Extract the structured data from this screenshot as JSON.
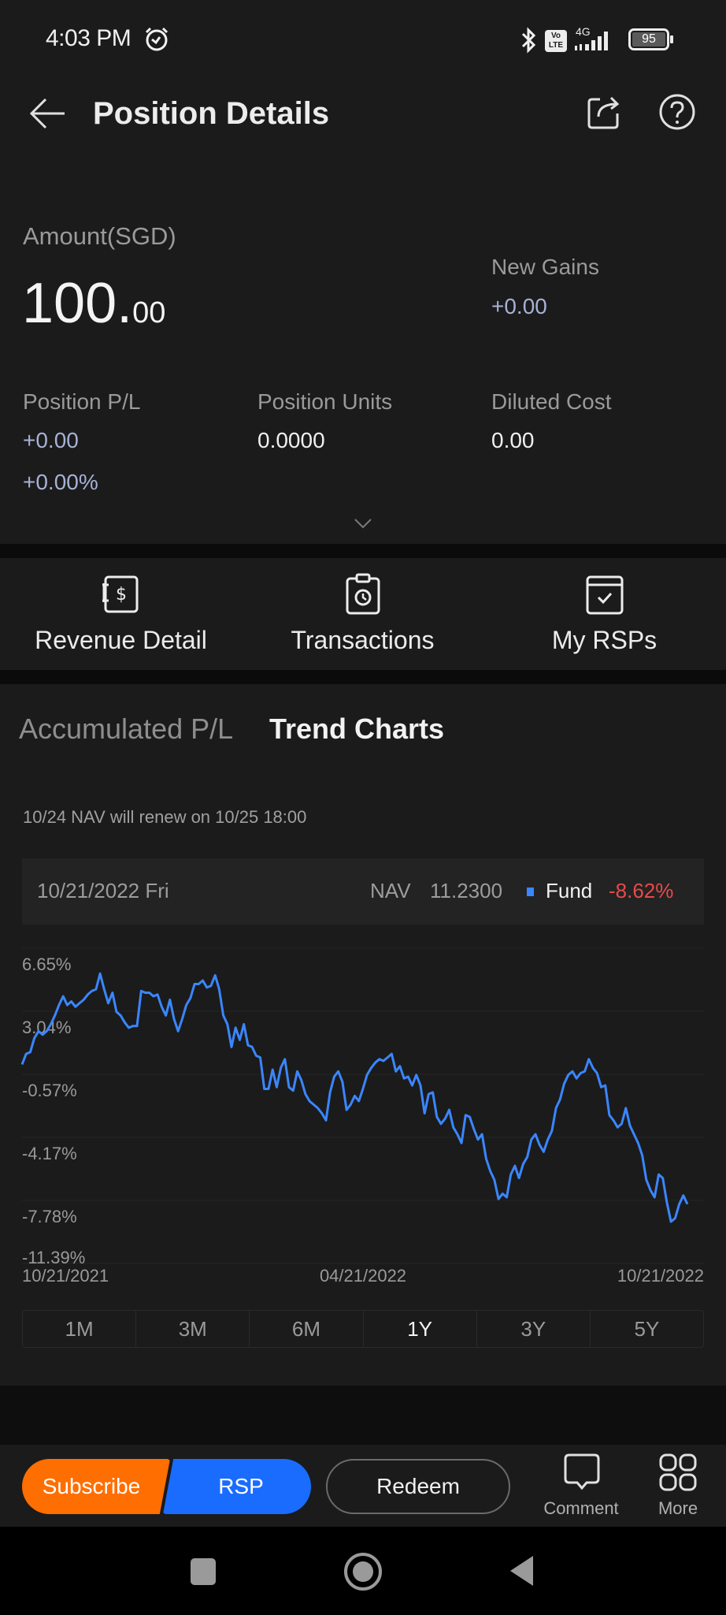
{
  "status_bar": {
    "time": "4:03 PM",
    "icons": [
      "alarm-icon",
      "bluetooth-icon",
      "volte-icon",
      "4g-signal-icon",
      "battery-icon"
    ],
    "network": "4G",
    "volte_line1": "Vo",
    "volte_line2": "LTE",
    "battery": "95"
  },
  "header": {
    "title": "Position Details",
    "back_icon": "arrow-left-icon",
    "share_icon": "share-icon",
    "help_icon": "help-icon"
  },
  "summary": {
    "amount_label": "Amount(SGD)",
    "amount_int": "100.",
    "amount_dec": "00",
    "new_gains_label": "New Gains",
    "new_gains_value": "+0.00",
    "position_pl_label": "Position P/L",
    "position_pl_value": "+0.00",
    "position_pl_pct": "+0.00%",
    "position_units_label": "Position Units",
    "position_units_value": "0.0000",
    "diluted_cost_label": "Diluted Cost",
    "diluted_cost_value": "0.00",
    "expand_icon": "chevron-down-icon"
  },
  "quick_actions": [
    {
      "label": "Revenue Detail",
      "icon": "revenue-dollar-icon"
    },
    {
      "label": "Transactions",
      "icon": "clipboard-clock-icon"
    },
    {
      "label": "My RSPs",
      "icon": "calendar-check-icon"
    }
  ],
  "tabs": [
    {
      "label": "Accumulated P/L",
      "active": false
    },
    {
      "label": "Trend Charts",
      "active": true
    }
  ],
  "nav_note": "10/24 NAV will renew on 10/25 18:00",
  "info_box": {
    "date": "10/21/2022 Fri",
    "nav_label": "NAV",
    "nav_value": "11.2300",
    "legend_label": "Fund",
    "legend_color": "#3a86ff",
    "change": "-8.62%",
    "change_color": "#e84a4a"
  },
  "chart_data": {
    "type": "line",
    "title": "",
    "xlabel": "",
    "ylabel": "",
    "y_tick_labels": [
      "6.65%",
      "3.04%",
      "-0.57%",
      "-4.17%",
      "-7.78%",
      "-11.39%"
    ],
    "y_ticks": [
      6.65,
      3.04,
      -0.57,
      -4.17,
      -7.78,
      -11.39
    ],
    "ylim": [
      -11.39,
      6.65
    ],
    "x_tick_labels": [
      "10/21/2021",
      "04/21/2022",
      "10/21/2022"
    ],
    "grid": true,
    "legend": "top-right",
    "series": [
      {
        "name": "Fund",
        "color": "#3a86ff",
        "x_range": [
          "10/21/2021",
          "10/21/2022"
        ],
        "values": [
          0.0,
          0.6,
          0.7,
          1.5,
          1.9,
          1.7,
          1.9,
          2.3,
          2.8,
          3.4,
          3.9,
          3.4,
          3.6,
          3.3,
          3.5,
          3.7,
          4.0,
          4.2,
          4.3,
          5.2,
          4.3,
          3.5,
          4.1,
          3.0,
          2.8,
          2.4,
          2.1,
          2.2,
          2.2,
          4.2,
          4.1,
          4.1,
          3.9,
          4.0,
          3.3,
          2.8,
          3.7,
          2.6,
          1.9,
          2.6,
          3.4,
          3.8,
          4.6,
          4.6,
          4.8,
          4.4,
          4.5,
          5.1,
          4.3,
          2.8,
          2.3,
          1.0,
          2.1,
          1.4,
          2.3,
          1.1,
          1.0,
          0.5,
          0.4,
          -1.4,
          -1.4,
          -0.3,
          -1.3,
          -0.2,
          0.3,
          -1.3,
          -1.5,
          -0.4,
          -0.9,
          -1.7,
          -2.1,
          -2.3,
          -2.5,
          -2.8,
          -3.2,
          -1.6,
          -0.7,
          -0.4,
          -1.0,
          -2.6,
          -2.3,
          -1.8,
          -2.1,
          -1.4,
          -0.6,
          -0.2,
          0.1,
          0.3,
          0.2,
          0.4,
          0.6,
          -0.4,
          -0.1,
          -0.8,
          -0.7,
          -1.2,
          -0.6,
          -1.2,
          -2.8,
          -1.7,
          -1.6,
          -3.0,
          -3.4,
          -3.1,
          -2.6,
          -3.6,
          -4.0,
          -4.5,
          -2.9,
          -3.0,
          -3.7,
          -4.3,
          -4.0,
          -5.4,
          -6.1,
          -6.6,
          -7.7,
          -7.4,
          -7.6,
          -6.3,
          -5.8,
          -6.5,
          -5.7,
          -5.3,
          -4.3,
          -4.0,
          -4.6,
          -5.0,
          -4.3,
          -3.8,
          -2.5,
          -2.0,
          -1.1,
          -0.6,
          -0.4,
          -0.8,
          -0.5,
          -0.4,
          0.3,
          -0.2,
          -0.5,
          -1.3,
          -1.2,
          -2.9,
          -3.2,
          -3.6,
          -3.4,
          -2.5,
          -3.5,
          -4.0,
          -4.5,
          -5.2,
          -6.6,
          -7.2,
          -7.6,
          -6.3,
          -6.5,
          -7.9,
          -9.0,
          -8.8,
          -8.0,
          -7.5,
          -8.0
        ]
      }
    ]
  },
  "periods": [
    {
      "label": "1M",
      "active": false
    },
    {
      "label": "3M",
      "active": false
    },
    {
      "label": "6M",
      "active": false
    },
    {
      "label": "1Y",
      "active": true
    },
    {
      "label": "3Y",
      "active": false
    },
    {
      "label": "5Y",
      "active": false
    }
  ],
  "bottom_bar": {
    "subscribe_label": "Subscribe",
    "subscribe_color": "#ff6e00",
    "rsp_label": "RSP",
    "rsp_color": "#1a6cff",
    "redeem_label": "Redeem",
    "comment_label": "Comment",
    "comment_icon": "comment-bubble-icon",
    "more_label": "More",
    "more_icon": "grid-icon"
  },
  "nav_bar": {
    "recents_icon": "square-recents-icon",
    "home_icon": "circle-home-icon",
    "back_icon": "triangle-back-icon"
  }
}
